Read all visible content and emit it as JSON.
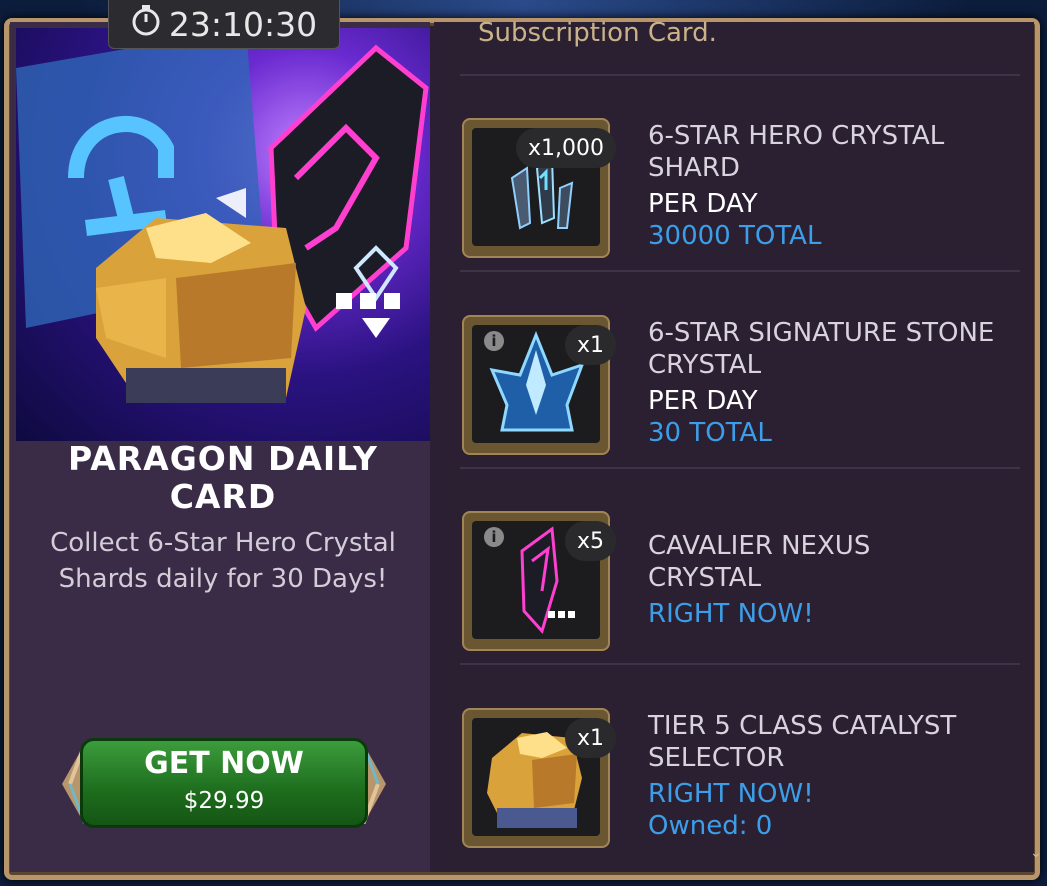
{
  "timer": "23:10:30",
  "offer": {
    "title_line1": "PARAGON DAILY",
    "title_line2": "CARD",
    "desc_line1": "Collect 6-Star Hero Crystal",
    "desc_line2": "Shards daily for 30 Days!",
    "button_label": "GET NOW",
    "price": "$29.99"
  },
  "top_caption": "Subscription Card.",
  "items": [
    {
      "qty": "x1,000",
      "name_line1": "6-STAR HERO CRYSTAL",
      "name_line2": "SHARD",
      "line3": "PER DAY",
      "line4": "30000 TOTAL",
      "has_info": false
    },
    {
      "qty": "x1",
      "name_line1": "6-STAR SIGNATURE STONE",
      "name_line2": "CRYSTAL",
      "line3": "PER DAY",
      "line4": "30 TOTAL",
      "has_info": true
    },
    {
      "qty": "x5",
      "name_line1": "CAVALIER NEXUS",
      "name_line2": "CRYSTAL",
      "line3": "RIGHT NOW!",
      "has_info": true
    },
    {
      "qty": "x1",
      "name_line1": "TIER 5 CLASS CATALYST",
      "name_line2": "SELECTOR",
      "line3": "RIGHT NOW!",
      "line4": "Owned: 0",
      "has_info": false
    }
  ],
  "icons": [
    "stopwatch-icon",
    "info-icon",
    "crystal-shard-icon",
    "signature-stone-icon",
    "nexus-crystal-icon",
    "catalyst-selector-icon"
  ],
  "colors": {
    "accent_blue": "#3c9ee8",
    "button_green": "#1d6d1d",
    "frame_gold": "#b8956a"
  }
}
